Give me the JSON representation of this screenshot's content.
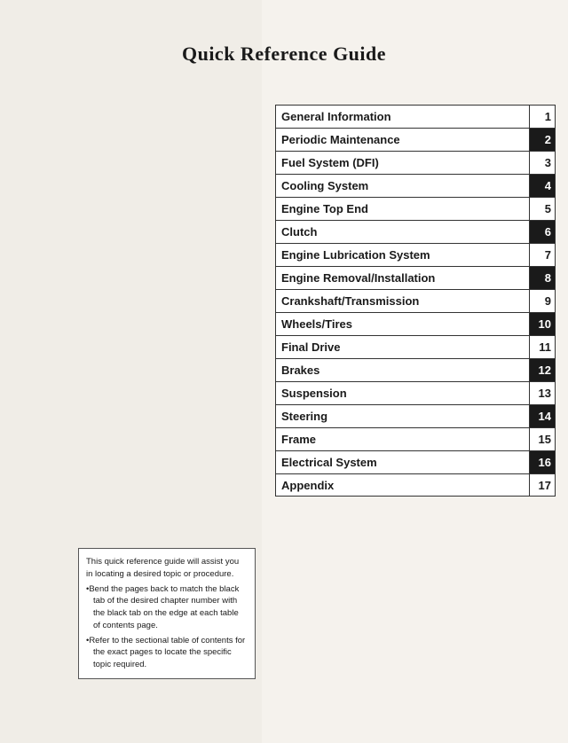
{
  "page": {
    "title": "Quick Reference Guide",
    "background": "#f5f2ed"
  },
  "toc": {
    "items": [
      {
        "label": "General Information",
        "number": "1",
        "blackTab": false
      },
      {
        "label": "Periodic Maintenance",
        "number": "2",
        "blackTab": true
      },
      {
        "label": "Fuel System (DFI)",
        "number": "3",
        "blackTab": false
      },
      {
        "label": "Cooling System",
        "number": "4",
        "blackTab": true
      },
      {
        "label": "Engine Top End",
        "number": "5",
        "blackTab": false
      },
      {
        "label": "Clutch",
        "number": "6",
        "blackTab": true
      },
      {
        "label": "Engine Lubrication System",
        "number": "7",
        "blackTab": false
      },
      {
        "label": "Engine Removal/Installation",
        "number": "8",
        "blackTab": true
      },
      {
        "label": "Crankshaft/Transmission",
        "number": "9",
        "blackTab": false
      },
      {
        "label": "Wheels/Tires",
        "number": "10",
        "blackTab": true
      },
      {
        "label": "Final Drive",
        "number": "11",
        "blackTab": false
      },
      {
        "label": "Brakes",
        "number": "12",
        "blackTab": true
      },
      {
        "label": "Suspension",
        "number": "13",
        "blackTab": false
      },
      {
        "label": "Steering",
        "number": "14",
        "blackTab": true
      },
      {
        "label": "Frame",
        "number": "15",
        "blackTab": false
      },
      {
        "label": "Electrical System",
        "number": "16",
        "blackTab": true
      },
      {
        "label": "Appendix",
        "number": "17",
        "blackTab": false
      }
    ]
  },
  "note": {
    "line1": "This quick reference guide will assist you in locating a desired topic or procedure.",
    "bullet1": "•Bend the pages back to match the black tab of the desired chapter number with the black tab on the edge at each table of contents page.",
    "bullet2": "•Refer to the sectional table of contents for the exact pages to locate the specific topic required."
  }
}
